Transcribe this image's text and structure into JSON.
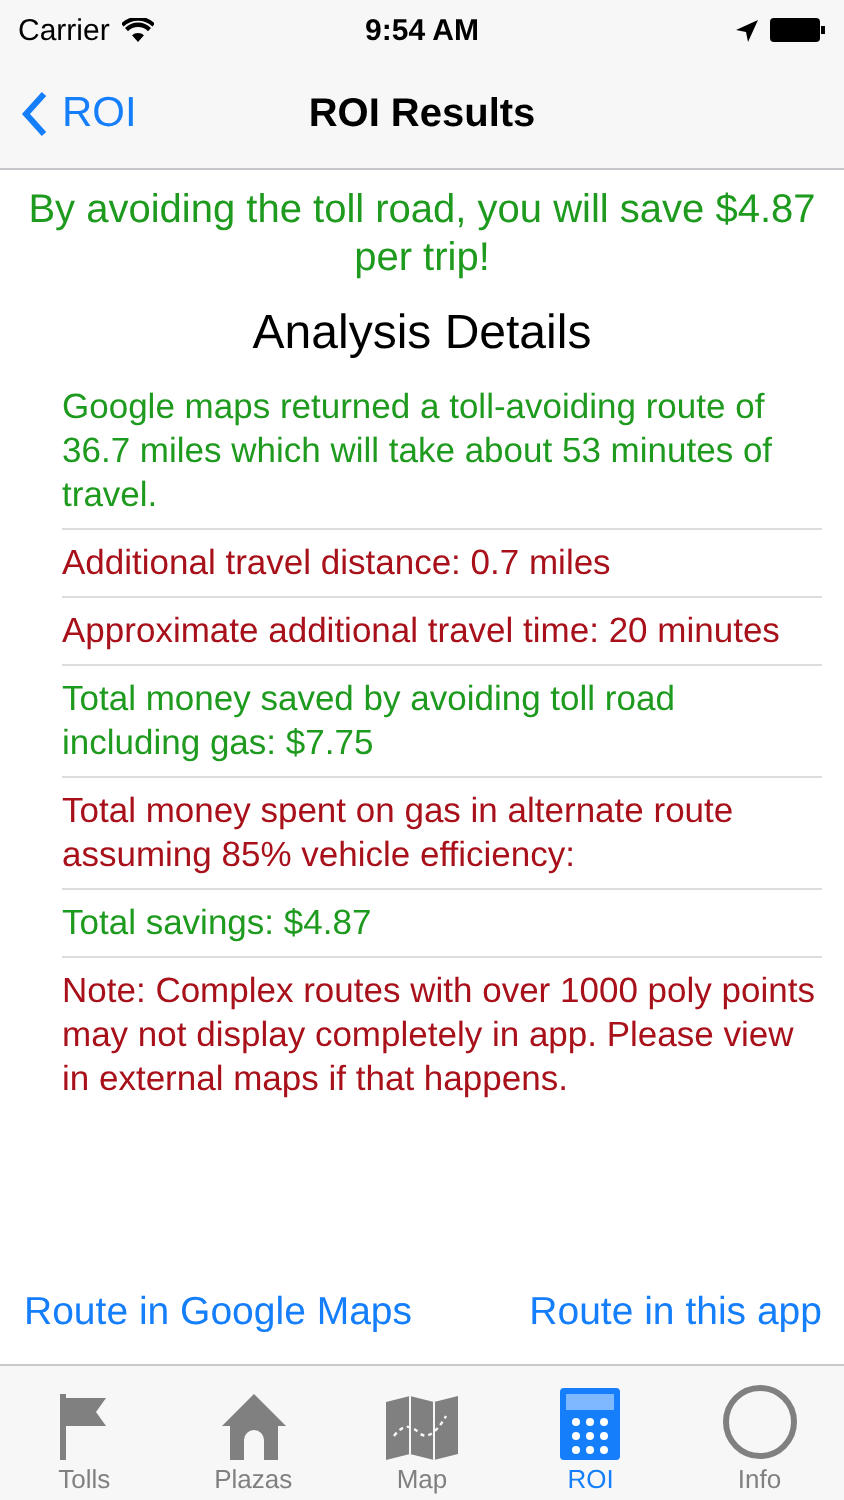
{
  "status_bar": {
    "carrier": "Carrier",
    "time": "9:54 AM"
  },
  "nav_bar": {
    "back": "ROI",
    "title": "ROI Results"
  },
  "headline": "By avoiding the toll road, you will save $4.87 per trip!",
  "section_title": "Analysis Details",
  "details": [
    {
      "text": "Google maps returned a toll-avoiding route of 36.7 miles which will take about 53 minutes of travel.",
      "color": "#1e9a1e"
    },
    {
      "text": "Additional travel distance: 0.7 miles",
      "color": "#a8101a"
    },
    {
      "text": "Approximate additional travel time: 20 minutes",
      "color": "#a8101a"
    },
    {
      "text": "Total money saved by avoiding toll road including gas: $7.75",
      "color": "#1e9a1e"
    },
    {
      "text": "Total money spent on gas in alternate route assuming 85% vehicle efficiency:",
      "color": "#a8101a"
    },
    {
      "text": "Total savings: $4.87",
      "color": "#1e9a1e"
    },
    {
      "text": "Note: Complex routes with over 1000 poly points may not display completely in app. Please view in external maps if that happens.",
      "color": "#a8101a"
    }
  ],
  "links": [
    "Route in Google Maps",
    "Route in this app"
  ],
  "tabs": [
    {
      "label": "Tolls",
      "selected": false
    },
    {
      "label": "Plazas",
      "selected": false
    },
    {
      "label": "Map",
      "selected": false
    },
    {
      "label": "ROI",
      "selected": true
    },
    {
      "label": "Info",
      "selected": false
    }
  ]
}
